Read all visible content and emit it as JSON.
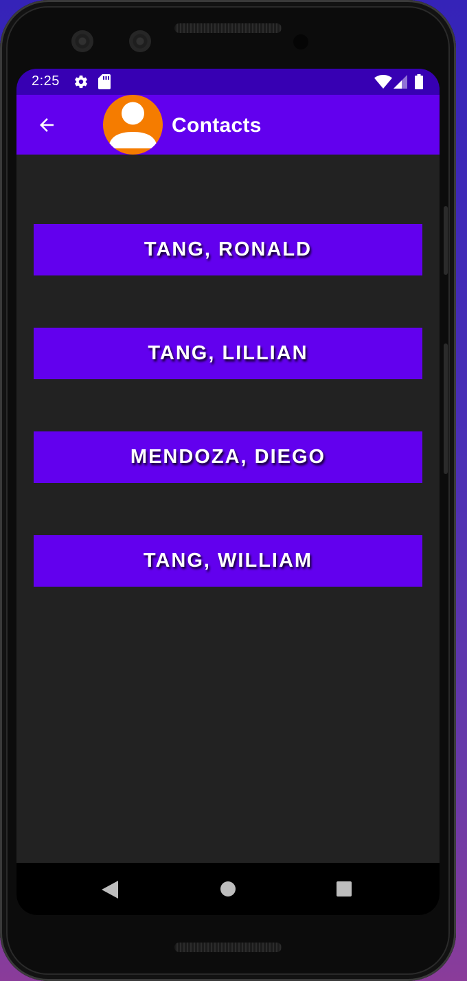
{
  "status_bar": {
    "time": "2:25",
    "icons": [
      "gear-icon",
      "sd-card-icon",
      "wifi-icon",
      "cell-signal-icon",
      "battery-icon"
    ]
  },
  "app_bar": {
    "title": "Contacts",
    "back_icon": "arrow-back-icon",
    "avatar_icon": "person-avatar-icon"
  },
  "contacts": [
    {
      "label": "TANG, RONALD"
    },
    {
      "label": "TANG, LILLIAN"
    },
    {
      "label": "MENDOZA, DIEGO"
    },
    {
      "label": "TANG, WILLIAM"
    }
  ],
  "nav_bar": {
    "icons": [
      "nav-back-icon",
      "nav-home-icon",
      "nav-recents-icon"
    ]
  },
  "colors": {
    "status_bar": "#3700b3",
    "app_bar": "#6200ee",
    "button": "#6200ee",
    "background": "#222222",
    "avatar": "#f57c00"
  }
}
